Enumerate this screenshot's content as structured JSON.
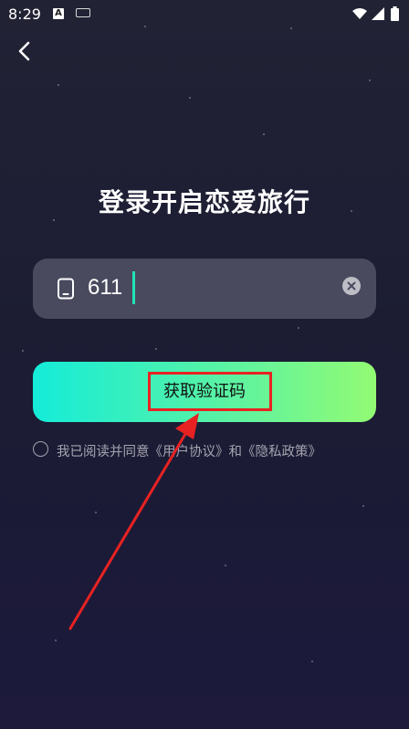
{
  "status_bar": {
    "time": "8:29",
    "notification_icons": [
      "a-app-icon",
      "keyboard-icon"
    ],
    "system_icons": [
      "wifi-icon",
      "signal-icon",
      "battery-icon"
    ]
  },
  "header": {
    "back_icon": "chevron-left-icon"
  },
  "title": "登录开启恋爱旅行",
  "phone_input": {
    "value": "611",
    "icon": "phone-icon",
    "clear_icon": "clear-icon"
  },
  "submit_button": {
    "label": "获取验证码"
  },
  "agreement": {
    "prefix": "我已阅读并同意",
    "user_agreement": "《用户协议》",
    "conjunction": "和",
    "privacy_policy": "《隐私政策》"
  },
  "annotation": {
    "box_color": "#e82222",
    "arrow_color": "#e82222"
  },
  "colors": {
    "button_gradient_start": "#14ecd9",
    "button_gradient_end": "#92fb73",
    "caret": "#22e3b8",
    "input_bg": "#494a5e"
  }
}
